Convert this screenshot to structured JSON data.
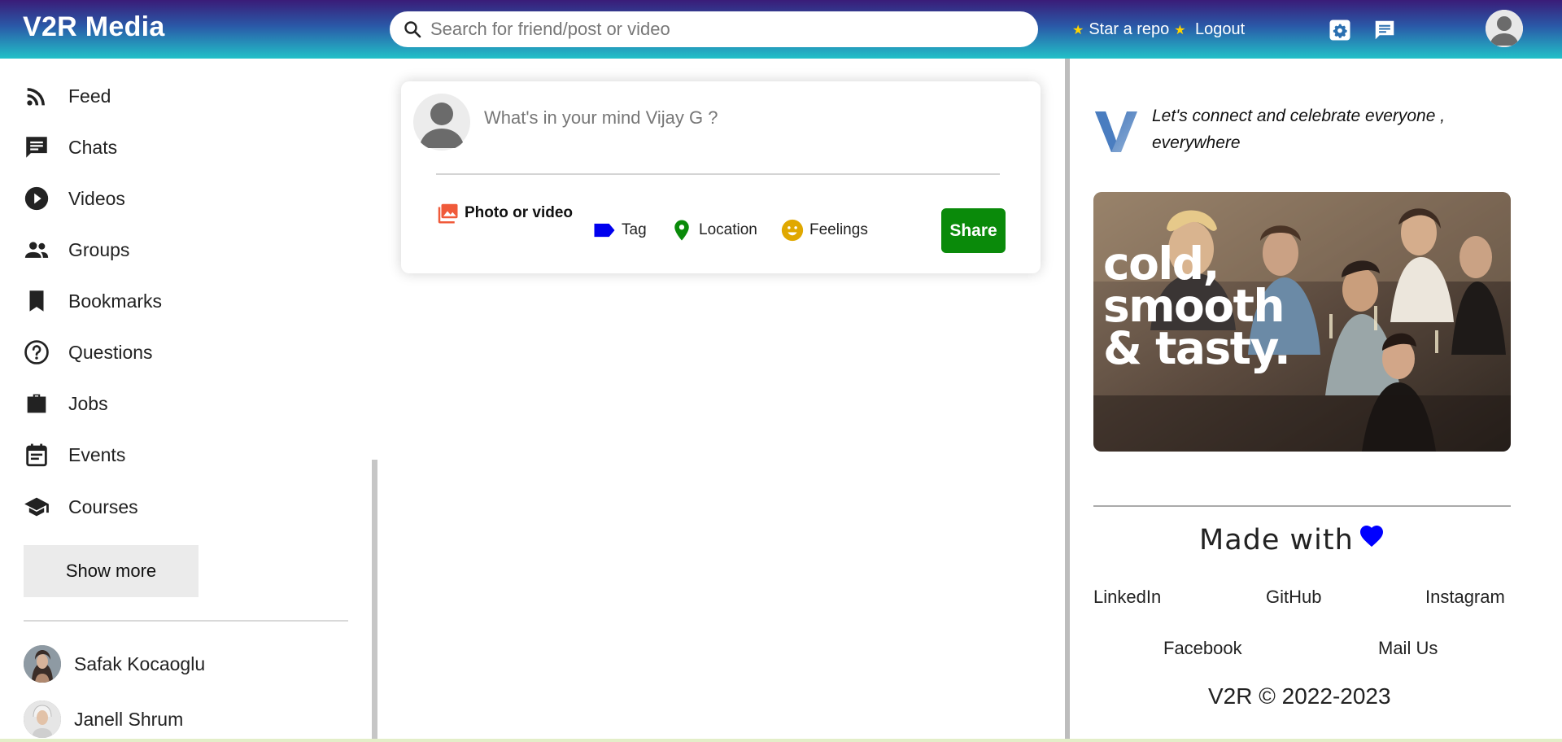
{
  "app": {
    "title": "V2R Media"
  },
  "search": {
    "placeholder": "Search for friend/post or video",
    "icon": "search-icon"
  },
  "topbar": {
    "star_repo_label": "Star a repo",
    "logout_label": "Logout",
    "icons": [
      "settings-icon",
      "chat-icon",
      "avatar-icon"
    ]
  },
  "sidebar": {
    "items": [
      {
        "label": "Feed",
        "icon": "rss-feed-icon"
      },
      {
        "label": "Chats",
        "icon": "chat-icon"
      },
      {
        "label": "Videos",
        "icon": "play-circle-icon"
      },
      {
        "label": "Groups",
        "icon": "group-icon"
      },
      {
        "label": "Bookmarks",
        "icon": "bookmark-icon"
      },
      {
        "label": "Questions",
        "icon": "help-circle-icon"
      },
      {
        "label": "Jobs",
        "icon": "briefcase-icon"
      },
      {
        "label": "Events",
        "icon": "calendar-icon"
      },
      {
        "label": "Courses",
        "icon": "school-icon"
      }
    ],
    "show_more_label": "Show more",
    "friends": [
      {
        "name": "Safak Kocaoglu"
      },
      {
        "name": "Janell Shrum"
      }
    ]
  },
  "post": {
    "placeholder": "What's in your mind Vijay G ?",
    "options": {
      "photo_label": "Photo or video",
      "tag_label": "Tag",
      "location_label": "Location",
      "feelings_label": "Feelings"
    },
    "share_label": "Share"
  },
  "right": {
    "tagline_line1": "Let's connect and celebrate everyone ,",
    "tagline_line2": "everywhere",
    "promo_line1": "cold,",
    "promo_line2": "smooth",
    "promo_line3": "& tasty.",
    "made_with_label": "Made with",
    "links": {
      "linkedin": "LinkedIn",
      "github": "GitHub",
      "instagram": "Instagram",
      "facebook": "Facebook",
      "mail": "Mail Us"
    },
    "copyright": "V2R © 2022-2023"
  },
  "colors": {
    "share_button": "#0a8a0a",
    "heart": "#0000ff",
    "tag_icon": "#0000ee",
    "location_icon": "#0a8a0a",
    "feelings_icon": "#e0a800",
    "photo_icon": "#f05a3a"
  }
}
